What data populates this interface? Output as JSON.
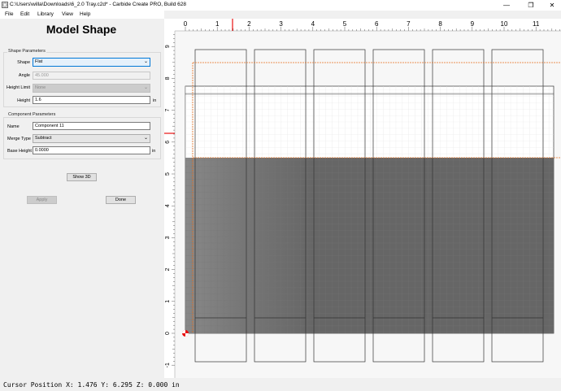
{
  "window": {
    "title": "C:\\Users\\willa\\Downloads\\6_2.0 Tray.c2d* - Carbide Create PRO, Build 628",
    "minimize": "—",
    "restore": "❐",
    "close": "✕"
  },
  "menu": [
    "File",
    "Edit",
    "Library",
    "View",
    "Help"
  ],
  "panel": {
    "heading": "Model Shape",
    "shape_params": {
      "title": "Shape Parameters",
      "shape_label": "Shape",
      "shape_value": "Flat",
      "angle_label": "Angle",
      "angle_value": "45.000",
      "height_limit_label": "Height Limit",
      "height_limit_value": "None",
      "height_label": "Height",
      "height_value": "1.6",
      "height_unit": "in"
    },
    "component_params": {
      "title": "Component Parameters",
      "name_label": "Name",
      "name_value": "Component 11",
      "merge_label": "Merge Type",
      "merge_value": "Subtract",
      "base_label": "Base Height",
      "base_value": "0.0000",
      "base_unit": "in"
    },
    "show3d": "Show 3D",
    "apply": "Apply",
    "done": "Done"
  },
  "ruler": {
    "x_ticks": [
      "0",
      "1",
      "2",
      "3",
      "4",
      "5",
      "6",
      "7",
      "8",
      "9",
      "10",
      "11"
    ],
    "y_ticks": [
      "9",
      "8",
      "7",
      "6",
      "5",
      "4",
      "3",
      "2",
      "1",
      "0",
      "-1"
    ]
  },
  "status": {
    "cursor": "Cursor Position X: 1.476 Y: 6.295 Z: 0.000 in"
  },
  "colors": {
    "shaded_region": "#666666",
    "stock_outline": "#333333",
    "orange_guide": "#e87020",
    "cursor_marker": "#e81010",
    "grid_line": "#e4e4e4"
  },
  "icons": {
    "app": "carbide-create-app-icon",
    "dropdown": "chevron-down-icon",
    "origin": "origin-marker-icon"
  }
}
